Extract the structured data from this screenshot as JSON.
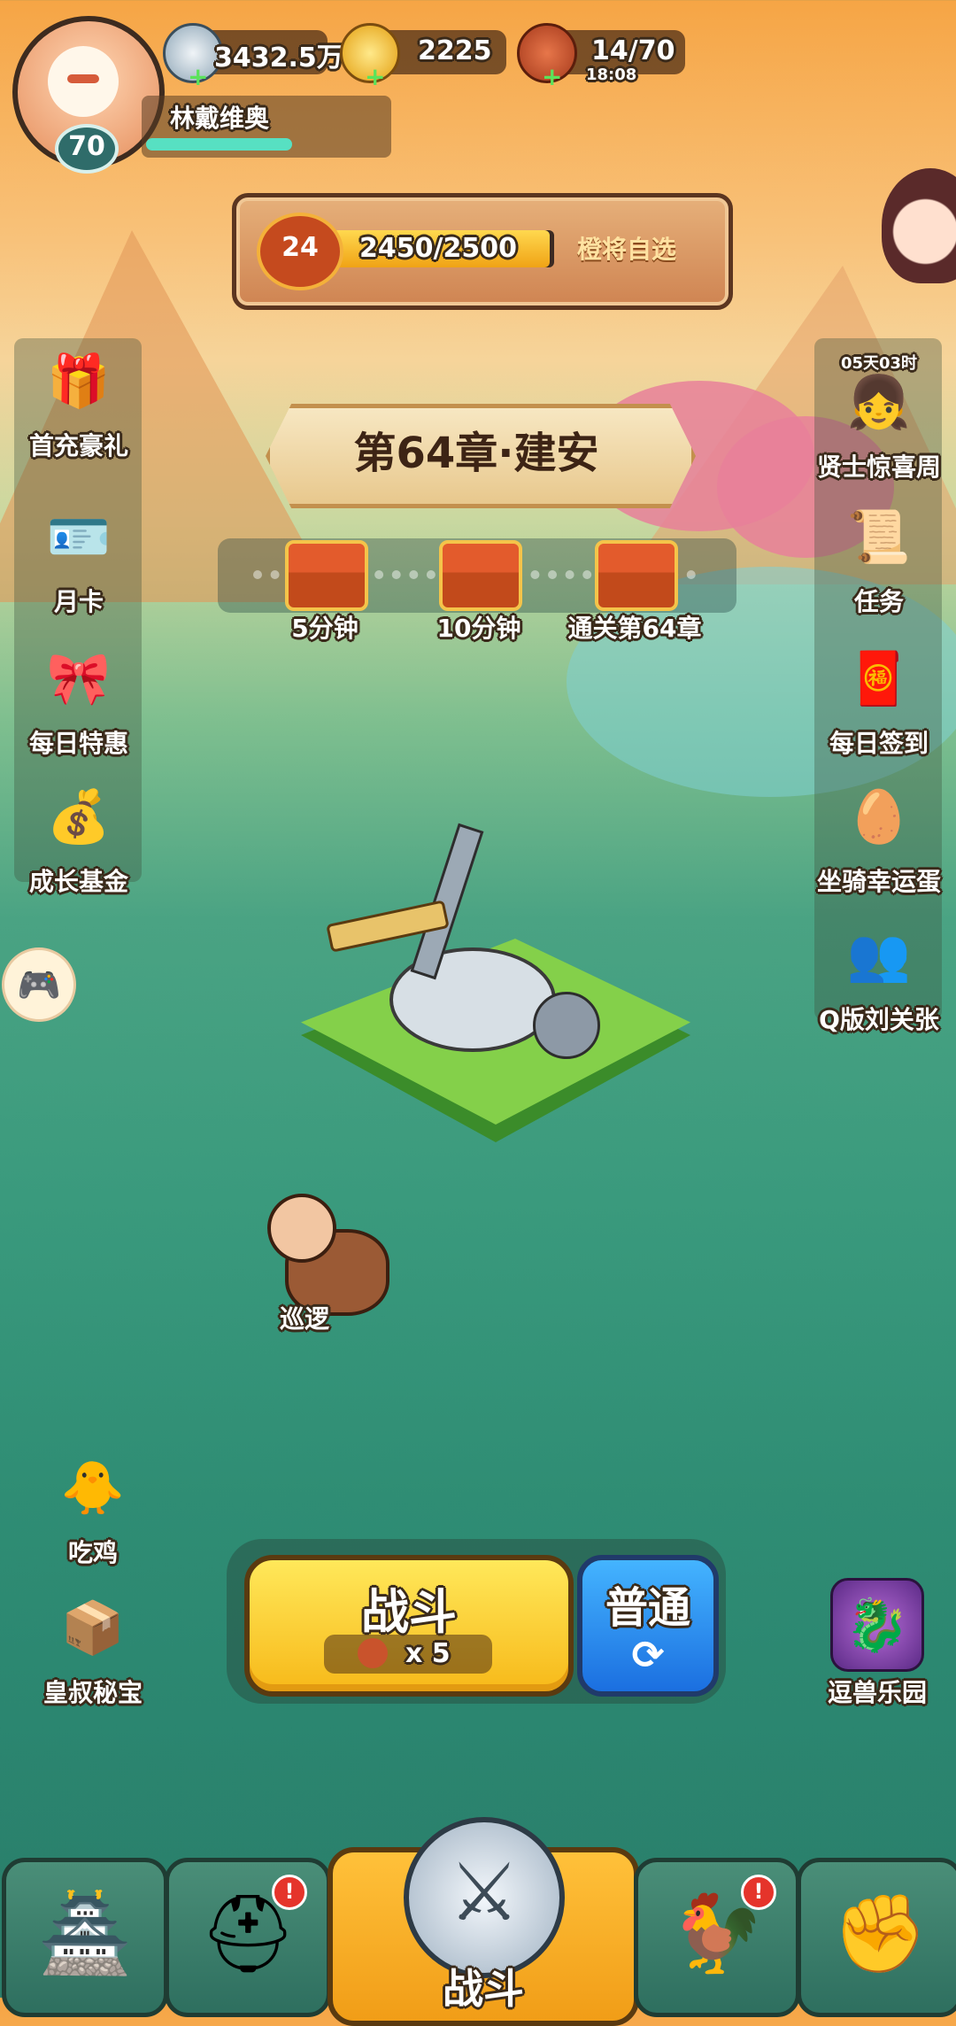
{
  "player": {
    "name": "林戴维奥",
    "level": "70"
  },
  "resources": {
    "silver": "3432.5万",
    "gold": "2225",
    "stamina": "14/70",
    "stamina_timer": "18:08"
  },
  "progress": {
    "rank": "24",
    "current": "2450/2500",
    "label": "橙将自选",
    "fraction": 0.98
  },
  "chapter": {
    "title": "第64章·建安"
  },
  "chests": [
    {
      "label": "5分钟"
    },
    {
      "label": "10分钟"
    },
    {
      "label": "通关第64章"
    }
  ],
  "left_menu": [
    {
      "label": "首充豪礼",
      "icon": "treasure-chest-icon"
    },
    {
      "label": "月卡",
      "icon": "month-card-icon"
    },
    {
      "label": "每日特惠",
      "icon": "gift-bag-icon"
    },
    {
      "label": "成长基金",
      "icon": "fund-icon"
    }
  ],
  "right_menu": [
    {
      "label": "贤士惊喜周",
      "icon": "sage-icon",
      "timer": "05天03时"
    },
    {
      "label": "任务",
      "icon": "scroll-icon"
    },
    {
      "label": "每日签到",
      "icon": "sign-in-icon"
    },
    {
      "label": "坐骑幸运蛋",
      "icon": "egg-icon"
    },
    {
      "label": "Q版刘关张",
      "icon": "heroes-icon"
    }
  ],
  "patrol": {
    "label": "巡逻"
  },
  "left_bottom": [
    {
      "label": "吃鸡",
      "icon": "chicken-icon"
    },
    {
      "label": "皇叔秘宝",
      "icon": "treasure-icon"
    }
  ],
  "right_bottom": {
    "label": "逗兽乐园",
    "icon": "beast-icon"
  },
  "battle": {
    "fight_label": "战斗",
    "cost": "x 5",
    "mode_label": "普通"
  },
  "bottom_nav": [
    {
      "name": "city",
      "icon": "palace-icon",
      "badge": ""
    },
    {
      "name": "heroes",
      "icon": "helmet-icon",
      "badge": "!"
    },
    {
      "name": "battle",
      "label": "战斗",
      "icon": "swords-icon",
      "badge": ""
    },
    {
      "name": "pets",
      "icon": "rooster-icon",
      "badge": "!"
    },
    {
      "name": "upgrade",
      "icon": "fist-icon",
      "badge": ""
    }
  ]
}
